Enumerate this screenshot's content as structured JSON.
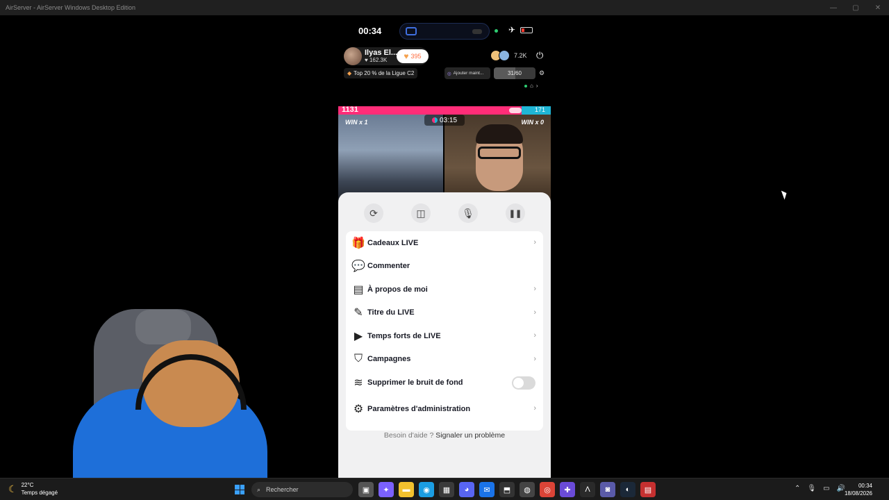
{
  "window": {
    "title": "AirServer - AirServer Windows Desktop Edition",
    "controls": [
      "—",
      "▢",
      "✕"
    ]
  },
  "phone": {
    "status": {
      "time": "00:34"
    },
    "host": {
      "name": "Ilyas El...",
      "likes": "162.3K",
      "follow_count": "395"
    },
    "viewers": {
      "count": "7.2K"
    },
    "league": "Top 20 % de la Ligue C2",
    "add_chip": "Ajouter maint...",
    "progress": {
      "label": "31/60",
      "fraction": 0.52
    },
    "battle": {
      "score_left": "1131",
      "score_right": "171",
      "win_left": "WIN x 1",
      "win_right": "WIN x 0",
      "timer": "03:15"
    },
    "menu": {
      "controls": [
        {
          "name": "flip-camera-icon",
          "glyph": "⟳"
        },
        {
          "name": "mirror-icon",
          "glyph": "◫"
        },
        {
          "name": "microphone-icon",
          "glyph": "🎙"
        },
        {
          "name": "pause-icon",
          "glyph": "❚❚"
        }
      ],
      "items": [
        {
          "label": "Cadeaux LIVE",
          "icon": "gift-icon",
          "glyph": "🎁",
          "chevron": true
        },
        {
          "label": "Commenter",
          "icon": "comment-icon",
          "glyph": "💬",
          "chevron": false
        },
        {
          "label": "À propos de moi",
          "icon": "document-icon",
          "glyph": "▤",
          "chevron": true
        },
        {
          "label": "Titre du LIVE",
          "icon": "pencil-icon",
          "glyph": "✎",
          "chevron": true
        },
        {
          "label": "Temps forts de LIVE",
          "icon": "highlight-icon",
          "glyph": "▶",
          "chevron": true
        },
        {
          "label": "Campagnes",
          "icon": "shield-icon",
          "glyph": "⛉",
          "chevron": true
        },
        {
          "label": "Supprimer le bruit de fond",
          "icon": "soundwave-icon",
          "glyph": "≋",
          "toggle": false
        }
      ],
      "admin": {
        "label": "Paramètres d'administration",
        "icon": "gear-icon",
        "glyph": "⚙"
      },
      "help": {
        "prefix": "Besoin d'aide ?",
        "link": "Signaler un problème"
      }
    }
  },
  "taskbar": {
    "weather": {
      "temp": "22°C",
      "desc": "Temps dégagé"
    },
    "search_placeholder": "Rechercher",
    "apps": [
      {
        "name": "task-view-icon",
        "glyph": "▣",
        "color": "#555"
      },
      {
        "name": "copilot-icon",
        "glyph": "✦",
        "color": "#7b61ff"
      },
      {
        "name": "file-explorer-icon",
        "glyph": "▬",
        "color": "#f2c12e"
      },
      {
        "name": "edge-icon",
        "glyph": "◉",
        "color": "#1b9de2"
      },
      {
        "name": "store-icon",
        "glyph": "▦",
        "color": "#3a3a3a"
      },
      {
        "name": "discord-icon",
        "glyph": "◕",
        "color": "#5865f2"
      },
      {
        "name": "mail-icon",
        "glyph": "✉",
        "color": "#1a73e8"
      },
      {
        "name": "mirror-app-icon",
        "glyph": "⬒",
        "color": "#333"
      },
      {
        "name": "obs-icon",
        "glyph": "◍",
        "color": "#444"
      },
      {
        "name": "chrome-icon",
        "glyph": "◎",
        "color": "#db4437"
      },
      {
        "name": "gamepad-icon",
        "glyph": "✚",
        "color": "#6a4bd8"
      },
      {
        "name": "anchor-icon",
        "glyph": "Λ",
        "color": "#2a2a2a"
      },
      {
        "name": "chat-app-icon",
        "glyph": "◙",
        "color": "#5a5aa8"
      },
      {
        "name": "steam-icon",
        "glyph": "◐",
        "color": "#1b2838"
      },
      {
        "name": "news-icon",
        "glyph": "▤",
        "color": "#c53030"
      }
    ],
    "clock": {
      "time": "00:34",
      "date": "18/08/2026"
    }
  }
}
